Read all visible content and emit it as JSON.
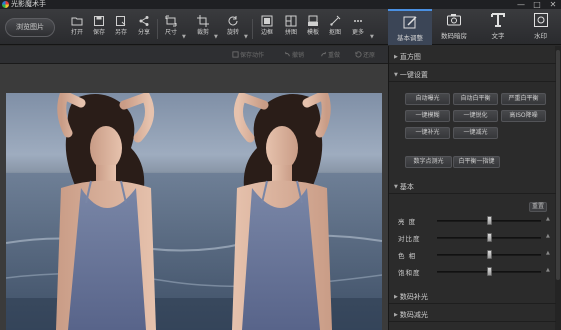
{
  "window": {
    "title": "光影魔术手",
    "controls": {
      "minimize": "—",
      "maximize": "□",
      "close": "✕"
    }
  },
  "toolbar": {
    "browse_label": "浏览图片",
    "tools": [
      {
        "label": "打开",
        "icon": "folder-icon"
      },
      {
        "label": "保存",
        "icon": "save-icon"
      },
      {
        "label": "另存",
        "icon": "save-as-icon"
      },
      {
        "label": "分享",
        "icon": "share-icon"
      },
      {
        "label": "尺寸",
        "icon": "resize-icon"
      },
      {
        "label": "裁剪",
        "icon": "crop-icon"
      },
      {
        "label": "旋转",
        "icon": "rotate-icon"
      },
      {
        "label": "边框",
        "icon": "frame-icon"
      },
      {
        "label": "拼图",
        "icon": "collage-icon"
      },
      {
        "label": "模板",
        "icon": "template-icon"
      },
      {
        "label": "抠图",
        "icon": "cutout-icon"
      },
      {
        "label": "更多",
        "icon": "more-icon"
      }
    ]
  },
  "mode_tabs": [
    {
      "label": "基本调整",
      "icon": "adjust-icon",
      "active": true
    },
    {
      "label": "数码暗房",
      "icon": "camera-icon",
      "active": false
    },
    {
      "label": "文字",
      "icon": "text-icon",
      "active": false
    },
    {
      "label": "水印",
      "icon": "watermark-icon",
      "active": false
    }
  ],
  "subbar": {
    "save_action": "保存动作",
    "undo": "撤销",
    "redo": "重做",
    "restore": "还原"
  },
  "panel": {
    "histogram": "直方图",
    "one_click": {
      "title": "一键设置",
      "buttons": [
        "自动曝光",
        "自动白平衡",
        "严重白平衡",
        "一键模糊",
        "一键锐化",
        "高ISO降噪",
        "一键补光",
        "一键减光"
      ],
      "extra_buttons": [
        "数字点测光",
        "白平衡一指键"
      ]
    },
    "basic": {
      "title": "基本",
      "reset": "重置",
      "sliders": [
        {
          "label": "亮 度",
          "value": 0.5
        },
        {
          "label": "对比度",
          "value": 0.5
        },
        {
          "label": "色 相",
          "value": 0.5
        },
        {
          "label": "饱和度",
          "value": 0.5
        }
      ]
    },
    "digital_fill": "数码补光",
    "digital_reduce": "数码减光"
  },
  "colors": {
    "accent": "#4a90e2",
    "toolbar_bg": "#2a2b2e",
    "panel_bg": "#2b2b2b"
  }
}
